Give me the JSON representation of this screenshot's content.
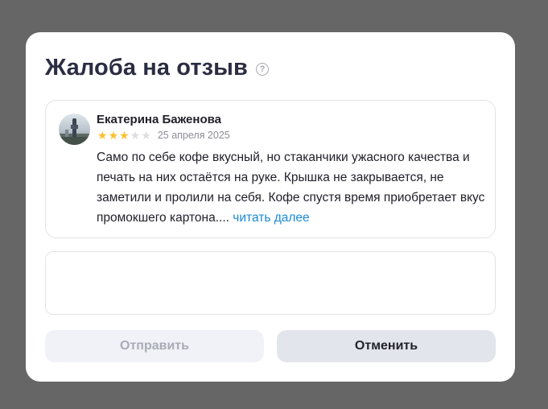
{
  "dialog": {
    "title": "Жалоба на отзыв",
    "help_icon": "question-circle-icon",
    "help_glyph": "?"
  },
  "review": {
    "author": "Екатерина Баженова",
    "avatar_icon": "user-photo-avatar",
    "rating": 3,
    "rating_max": 5,
    "star_glyph": "★",
    "date": "25 апреля 2025",
    "text": "Само по себе кофе вкусный, но стаканчики ужасного качества и печать на них остаётся на руке. Крышка не закрывается, не заметили и пролили на себя. Кофе спустя время приобретает вкус промокшего картона.... ",
    "read_more": "читать далее"
  },
  "complaint": {
    "value": "",
    "placeholder": ""
  },
  "buttons": {
    "send_label": "Отправить",
    "cancel_label": "Отменить"
  },
  "colors": {
    "overlay": "#666666",
    "star_on": "#fbc02d",
    "star_off": "#dddddf",
    "link": "#1a8bd6"
  }
}
